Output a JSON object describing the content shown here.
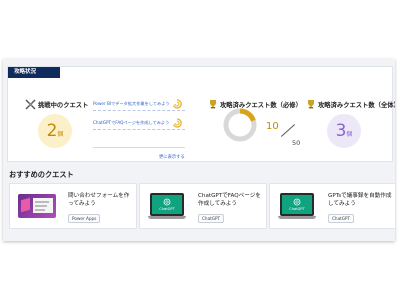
{
  "status": {
    "tab": "攻略状況",
    "in_progress": {
      "title": "挑戦中のクエスト",
      "count": "2",
      "unit": "個",
      "quests": [
        "Power BIでデータ拡大作業をしてみよう",
        "ChatGPTでFAQページを作成してみよう"
      ],
      "more": "更に表示する"
    },
    "required": {
      "title": "攻略済みクエスト数（必修）",
      "done": "10",
      "total": "50",
      "progress": 0.2
    },
    "all": {
      "title": "攻略済みクエスト数（全体）",
      "count": "3",
      "unit": "個"
    }
  },
  "recommended": {
    "title": "おすすめのクエスト",
    "cards": [
      {
        "title": "問い合わせフォームを作ってみよう",
        "tag": "Power Apps"
      },
      {
        "title": "ChatGPTでFAQページを作成してみよう",
        "tag": "ChatGPT",
        "screen_text": "ChatGPT"
      },
      {
        "title": "GPTsで議事録を自動作成してみよう",
        "tag": "ChatGPT",
        "screen_text": "ChatGPT"
      }
    ]
  },
  "colors": {
    "navy": "#0f2c5c",
    "gold": "#c28a0a",
    "purple": "#8b62d2",
    "gpt_green": "#10a37f"
  }
}
